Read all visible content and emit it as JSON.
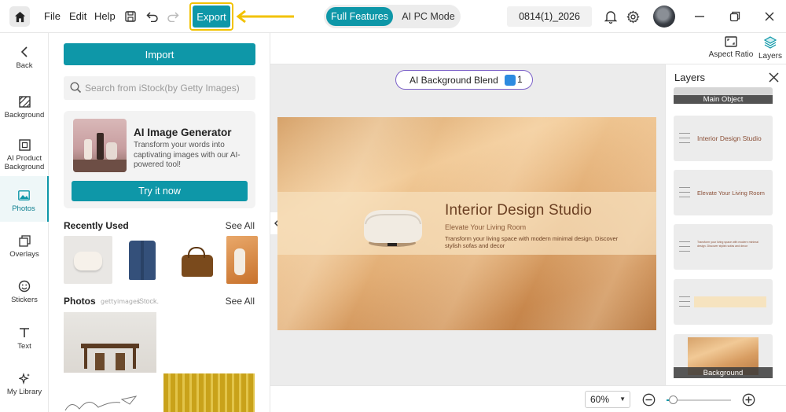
{
  "topbar": {
    "menu": [
      "File",
      "Edit",
      "Help"
    ],
    "export_label": "Export",
    "modes": [
      "Full Features",
      "AI PC Mode"
    ],
    "filename": "0814(1)_2026",
    "accent": "#0e97a8",
    "highlight": "#f2c200"
  },
  "rail": {
    "back": "Back",
    "items": [
      "Background",
      "AI Product Background",
      "Photos",
      "Overlays",
      "Stickers",
      "Text",
      "My Library"
    ],
    "active": "Photos"
  },
  "panel": {
    "import_label": "Import",
    "search_placeholder": "Search from iStock(by Getty Images)",
    "ai_card": {
      "title": "AI Image Generator",
      "description": "Transform your words into captivating images with our AI-powered tool!",
      "button": "Try it now"
    },
    "recently_used": {
      "title": "Recently Used",
      "see_all": "See All"
    },
    "photos": {
      "title": "Photos",
      "gettyimages": "gettyimages",
      "istock": "iStock.",
      "see_all": "See All"
    }
  },
  "canvas": {
    "blend_label": "AI Background Blend",
    "blend_count": "1",
    "design": {
      "title": "Interior Design Studio",
      "subtitle": "Elevate Your Living Room",
      "description": "Transform your living space with modern minimal design. Discover stylish sofas and decor"
    }
  },
  "right_tools": {
    "aspect_ratio": "Aspect Ratio",
    "layers": "Layers"
  },
  "layers_panel": {
    "title": "Layers",
    "items": [
      {
        "label": "Main Object"
      },
      {
        "text": "Interior Design Studio"
      },
      {
        "text": "Elevate Your Living Room"
      },
      {
        "text": "Transform your living space with modern minimal design. Discover stylish sofas and decor"
      },
      {
        "text": ""
      },
      {
        "label": "Background"
      }
    ]
  },
  "bottombar": {
    "zoom": "60%",
    "zoom_fraction": 0.1
  }
}
